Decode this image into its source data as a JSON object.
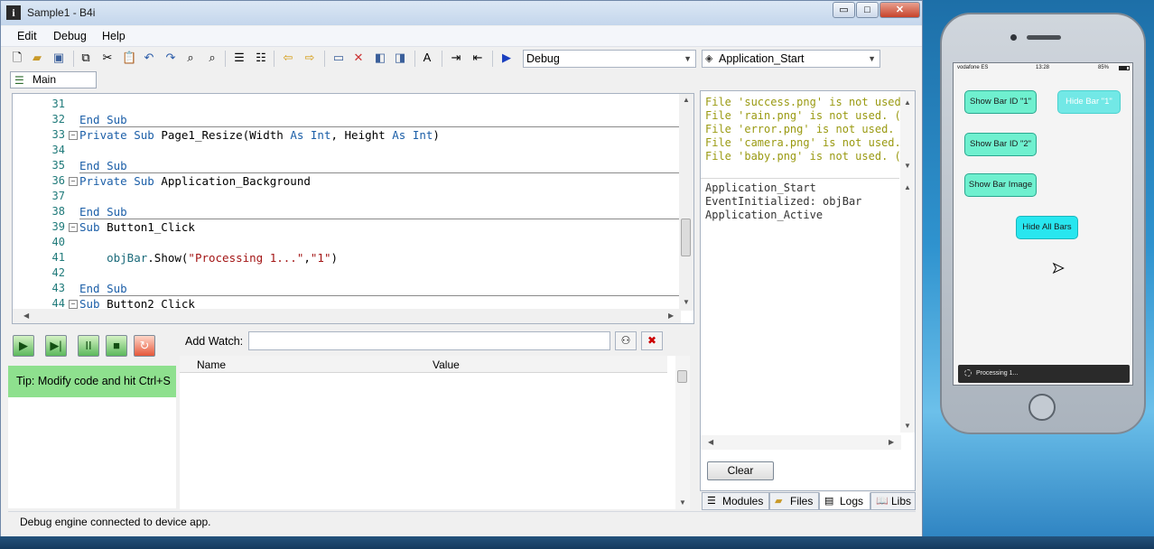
{
  "window": {
    "title": "Sample1 - B4i",
    "controls": {
      "minimize": "▭",
      "maximize": "□",
      "close": "✕"
    }
  },
  "menu": [
    "Edit",
    "Debug",
    "Help"
  ],
  "toolbar": {
    "mode_combo": "Debug",
    "module_combo": "Application_Start"
  },
  "module_tab": "Main",
  "editor": {
    "lines": [
      {
        "n": "31",
        "code": ""
      },
      {
        "n": "32",
        "code": "End Sub"
      },
      {
        "n": "33",
        "code": "Private Sub Page1_Resize(Width As Int, Height As Int)"
      },
      {
        "n": "34",
        "code": ""
      },
      {
        "n": "35",
        "code": "End Sub"
      },
      {
        "n": "36",
        "code": "Private Sub Application_Background"
      },
      {
        "n": "37",
        "code": ""
      },
      {
        "n": "38",
        "code": "End Sub"
      },
      {
        "n": "39",
        "code": "Sub Button1_Click"
      },
      {
        "n": "40",
        "code": ""
      },
      {
        "n": "41",
        "code": "    objBar.Show(\"Processing 1...\",\"1\")"
      },
      {
        "n": "42",
        "code": ""
      },
      {
        "n": "43",
        "code": "End Sub"
      },
      {
        "n": "44",
        "code": "Sub Button2_Click"
      }
    ]
  },
  "debug": {
    "tip": "Tip: Modify code and hit Ctrl+S",
    "add_watch_label": "Add Watch:",
    "watch_value": "",
    "col_name": "Name",
    "col_value": "Value"
  },
  "logs": {
    "warnings": [
      "File 'success.png' is not used.",
      "File 'rain.png' is not used. (w",
      "File 'error.png' is not used. (",
      "File 'camera.png' is not used.",
      "File 'baby.png' is not used. (w"
    ],
    "events": [
      "Application_Start",
      "EventInitialized: objBar",
      "Application_Active"
    ],
    "clear_label": "Clear"
  },
  "bottom_tabs": [
    "Modules",
    "Files",
    "Logs",
    "Libs"
  ],
  "status": "Debug engine connected to device app.",
  "phone": {
    "carrier": "vodafone ES",
    "time": "13:28",
    "battery": "85%",
    "buttons": {
      "show1": "Show Bar ID \"1\"",
      "hide1": "Hide Bar \"1\"",
      "show2": "Show Bar ID \"2\"",
      "show_image": "Show Bar Image",
      "hide_all": "Hide All Bars"
    },
    "bar_text": "Processing 1..."
  }
}
